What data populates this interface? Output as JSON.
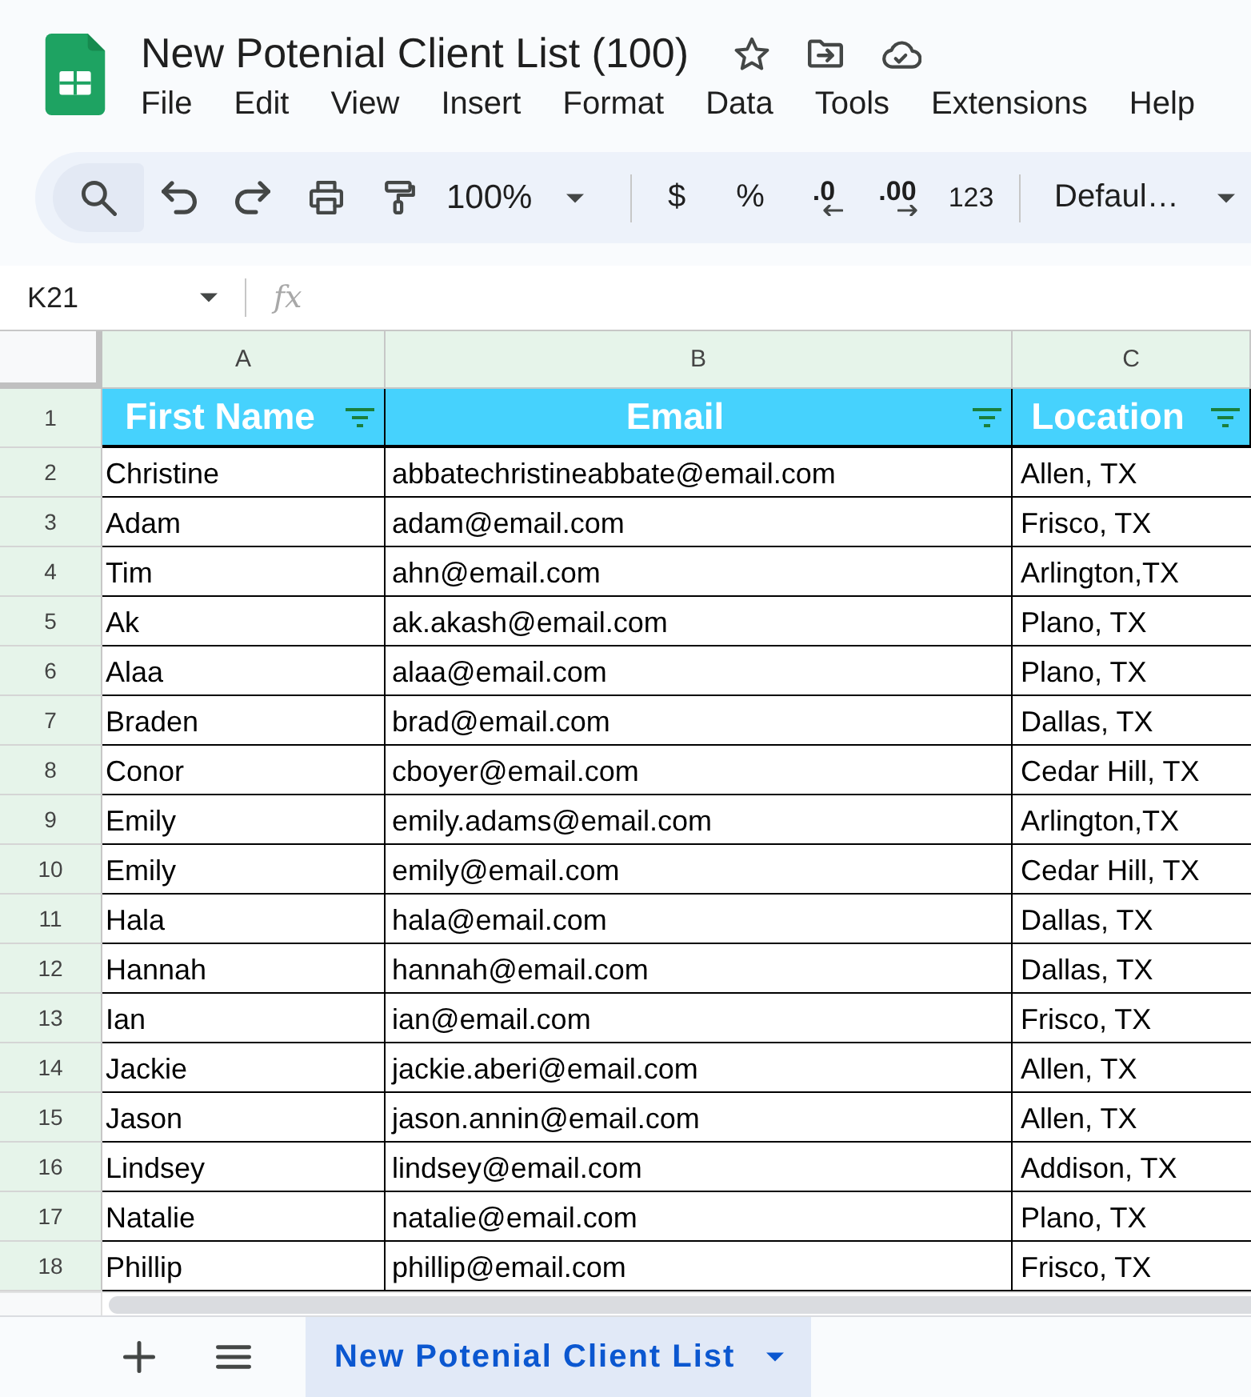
{
  "document": {
    "title": "New Potenial Client List (100)"
  },
  "menu": [
    "File",
    "Edit",
    "View",
    "Insert",
    "Format",
    "Data",
    "Tools",
    "Extensions",
    "Help"
  ],
  "toolbar": {
    "zoom": "100%",
    "currency": "$",
    "percent": "%",
    "decrease_decimals": ".0",
    "increase_decimals": ".00",
    "number_format": "123",
    "font": "Defaul…"
  },
  "formula_bar": {
    "cell_reference": "K21",
    "formula_label": "fx"
  },
  "sheet": {
    "header_row_number": "1",
    "columns": [
      {
        "letter": "A",
        "header": "First Name"
      },
      {
        "letter": "B",
        "header": "Email"
      },
      {
        "letter": "C",
        "header": "Location"
      }
    ],
    "rows": [
      {
        "number": "2",
        "cells": [
          "Christine",
          "abbatechristineabbate@email.com",
          "Allen, TX"
        ]
      },
      {
        "number": "3",
        "cells": [
          "Adam",
          "adam@email.com",
          "Frisco, TX"
        ]
      },
      {
        "number": "4",
        "cells": [
          "Tim",
          "ahn@email.com",
          "Arlington,TX"
        ]
      },
      {
        "number": "5",
        "cells": [
          "Ak",
          "ak.akash@email.com",
          "Plano, TX"
        ]
      },
      {
        "number": "6",
        "cells": [
          "Alaa",
          "alaa@email.com",
          "Plano, TX"
        ]
      },
      {
        "number": "7",
        "cells": [
          "Braden",
          "brad@email.com",
          "Dallas, TX"
        ]
      },
      {
        "number": "8",
        "cells": [
          "Conor",
          "cboyer@email.com",
          "Cedar Hill, TX"
        ]
      },
      {
        "number": "9",
        "cells": [
          "Emily",
          "emily.adams@email.com",
          "Arlington,TX"
        ]
      },
      {
        "number": "10",
        "cells": [
          "Emily",
          "emily@email.com",
          "Cedar Hill, TX"
        ]
      },
      {
        "number": "11",
        "cells": [
          "Hala",
          "hala@email.com",
          "Dallas, TX"
        ]
      },
      {
        "number": "12",
        "cells": [
          "Hannah",
          "hannah@email.com",
          "Dallas, TX"
        ]
      },
      {
        "number": "13",
        "cells": [
          "Ian",
          "ian@email.com",
          "Frisco, TX"
        ]
      },
      {
        "number": "14",
        "cells": [
          "Jackie",
          "jackie.aberi@email.com",
          "Allen, TX"
        ]
      },
      {
        "number": "15",
        "cells": [
          "Jason",
          "jason.annin@email.com",
          "Allen, TX"
        ]
      },
      {
        "number": "16",
        "cells": [
          "Lindsey",
          "lindsey@email.com",
          "Addison, TX"
        ]
      },
      {
        "number": "17",
        "cells": [
          "Natalie",
          "natalie@email.com",
          "Plano, TX"
        ]
      },
      {
        "number": "18",
        "cells": [
          "Phillip",
          "phillip@email.com",
          "Frisco, TX"
        ]
      }
    ]
  },
  "sheet_tabs": [
    {
      "label": "New Potenial Client List",
      "selected": true
    }
  ]
}
